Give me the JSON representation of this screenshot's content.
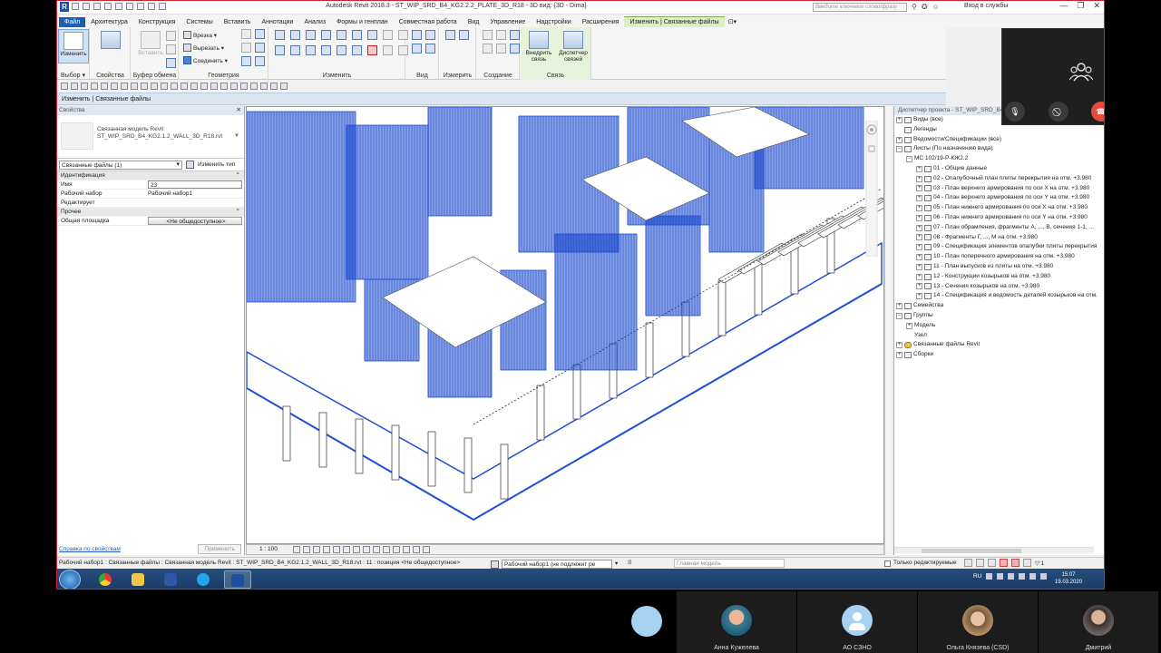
{
  "app": {
    "logo_letter": "R",
    "title": "Autodesk Revit 2018.3 -    ST_WIP_SRD_B4_KG2.2.2_PLATE_3D_R18 - 3D вид: {3D - Dima}",
    "search_placeholder": "Введите ключевое слово/фразу",
    "login": "Вход в службы",
    "win_min": "—",
    "win_max": "❐",
    "win_close": "✕"
  },
  "tabs": [
    {
      "label": "Файл",
      "kind": "file"
    },
    {
      "label": "Архитектура"
    },
    {
      "label": "Конструкция"
    },
    {
      "label": "Системы"
    },
    {
      "label": "Вставить"
    },
    {
      "label": "Аннотации"
    },
    {
      "label": "Анализ"
    },
    {
      "label": "Формы и генплан"
    },
    {
      "label": "Совместная работа"
    },
    {
      "label": "Вид"
    },
    {
      "label": "Управление"
    },
    {
      "label": "Надстройки"
    },
    {
      "label": "Расширения"
    },
    {
      "label": "Изменить | Связанные файлы",
      "kind": "ctx"
    },
    {
      "label": "⊡▾",
      "kind": "more"
    }
  ],
  "ribbon": {
    "modify_label": "Изменить",
    "select_label": "Выбор ▾",
    "properties_label": "Свойства",
    "clipboard_label": "Буфер обмена",
    "paste_label": "Вставить",
    "geometry_label": "Геометрия",
    "cut_label": "Врезка ▾",
    "trim_label": "Вырезать ▾",
    "join_label": "Соединить ▾",
    "modify_panel_label": "Изменить",
    "view_label": "Вид",
    "measure_label": "Измерить",
    "create_label": "Создание",
    "link_label": "Связь",
    "bind_link_label": "Внедрить связь",
    "manager_label": "Диспетчер связей"
  },
  "context_bar": "Изменить | Связанные файлы",
  "call": {
    "close": "✕"
  },
  "properties": {
    "header": "Свойства",
    "close": "✕",
    "type_name_line1": "Связанная модель Revit",
    "type_name_line2": "ST_WIP_SRD_B4_KG2.1.2_WALL_3D_R18.rvt",
    "selector": "Связанные файлы (1)",
    "edit_type": "Изменить тип",
    "group_ident": "Идентификация",
    "group_other": "Прочее",
    "rows_ident": [
      {
        "k": "Имя",
        "v": "23",
        "boxed": true
      },
      {
        "k": "Рабочий набор",
        "v": "Рабочий набор1"
      },
      {
        "k": "Редактирует",
        "v": ""
      }
    ],
    "rows_other": [
      {
        "k": "Общая площадка",
        "v": "<Не общедоступное>",
        "btn": true
      }
    ],
    "help_link": "Справка по свойствам",
    "apply": "Применить"
  },
  "viewbar": {
    "scale": "1 : 100"
  },
  "browser": {
    "header": "Диспетчер проекта - ST_WIP_SRD_B4_KG2.2.2_PLATE_3D_R18",
    "nodes": [
      {
        "depth": 0,
        "exp": "+",
        "label": "Виды (все)"
      },
      {
        "depth": 0,
        "exp": "",
        "label": "Легенды"
      },
      {
        "depth": 0,
        "exp": "+",
        "label": "Ведомости/Спецификации (все)"
      },
      {
        "depth": 0,
        "exp": "−",
        "label": "Листы (По назначению вида)"
      },
      {
        "depth": 1,
        "exp": "−",
        "label": "МС 102/19-Р-КЖ2.2",
        "noicon": true
      },
      {
        "depth": 2,
        "exp": "+",
        "label": "01 - Общие данные"
      },
      {
        "depth": 2,
        "exp": "+",
        "label": "02 - Опалубочный план плиты перекрытия на отм. +3.980"
      },
      {
        "depth": 2,
        "exp": "+",
        "label": "03 - План верхнего армирования по оси X на отм. +3.980"
      },
      {
        "depth": 2,
        "exp": "+",
        "label": "04 - План верхнего армирования по оси Y на отм. +3.980"
      },
      {
        "depth": 2,
        "exp": "+",
        "label": "05 - План нижнего армирования по оси X на отм. +3.980"
      },
      {
        "depth": 2,
        "exp": "+",
        "label": "06 - План нижнего армирования по оси Y на отм. +3.980"
      },
      {
        "depth": 2,
        "exp": "+",
        "label": "07 - План обрамления, фрагменты А, ..., В, сечения 1-1, ..."
      },
      {
        "depth": 2,
        "exp": "+",
        "label": "08 - Фрагменты Г, ..., М на отм. +3.980"
      },
      {
        "depth": 2,
        "exp": "+",
        "label": "09 - Спецификация элементов опалубки плиты перекрытия"
      },
      {
        "depth": 2,
        "exp": "+",
        "label": "10 - План поперечного армирования на отм. +3.980"
      },
      {
        "depth": 2,
        "exp": "+",
        "label": "11 - План выпусков из плиты на отм. +3.980"
      },
      {
        "depth": 2,
        "exp": "+",
        "label": "12 - Конструкции козырьков на отм. +3.980"
      },
      {
        "depth": 2,
        "exp": "+",
        "label": "13 - Сечения козырьков на отм. +3.980"
      },
      {
        "depth": 2,
        "exp": "+",
        "label": "14 - Спецификация и ведомость деталей козырьков на отм."
      },
      {
        "depth": 0,
        "exp": "+",
        "label": "Семейства"
      },
      {
        "depth": 0,
        "exp": "−",
        "label": "Группы"
      },
      {
        "depth": 1,
        "exp": "+",
        "label": "Модель",
        "noicon": true
      },
      {
        "depth": 1,
        "exp": "",
        "label": "Узел",
        "noicon": true
      },
      {
        "depth": 0,
        "exp": "+",
        "label": "Связанные файлы Revit",
        "chain": true
      },
      {
        "depth": 0,
        "exp": "+",
        "label": "Сборки"
      }
    ]
  },
  "status": {
    "text": "Рабочий набор1 : Связанные файлы : Связанная модель Revit : ST_WIP_SRD_B4_KG2.1.2_WALL_3D_R18.rvt : 11 : позиция <Не общедоступное>",
    "workset": "Рабочий набор1 (не подлежит ре",
    "number": ":0",
    "model": "Главная модель",
    "editonly": "Только редактируемые",
    "filter": "▽:1"
  },
  "taskbar": {
    "lang": "RU",
    "time": "15:07",
    "date": "19.03.2020"
  },
  "participants": [
    {
      "name": "Анна Кужелева",
      "avatar": "photo"
    },
    {
      "name": "АО СЗНО",
      "avatar": "default"
    },
    {
      "name": "Ольга Князева (CSD)",
      "avatar": "photo"
    },
    {
      "name": "Дмитрий",
      "avatar": "photo"
    }
  ],
  "colors": {
    "rebar_blue": "#1f4fd6",
    "file_tab": "#1b5fb0",
    "hangup_red": "#e64b3b"
  }
}
